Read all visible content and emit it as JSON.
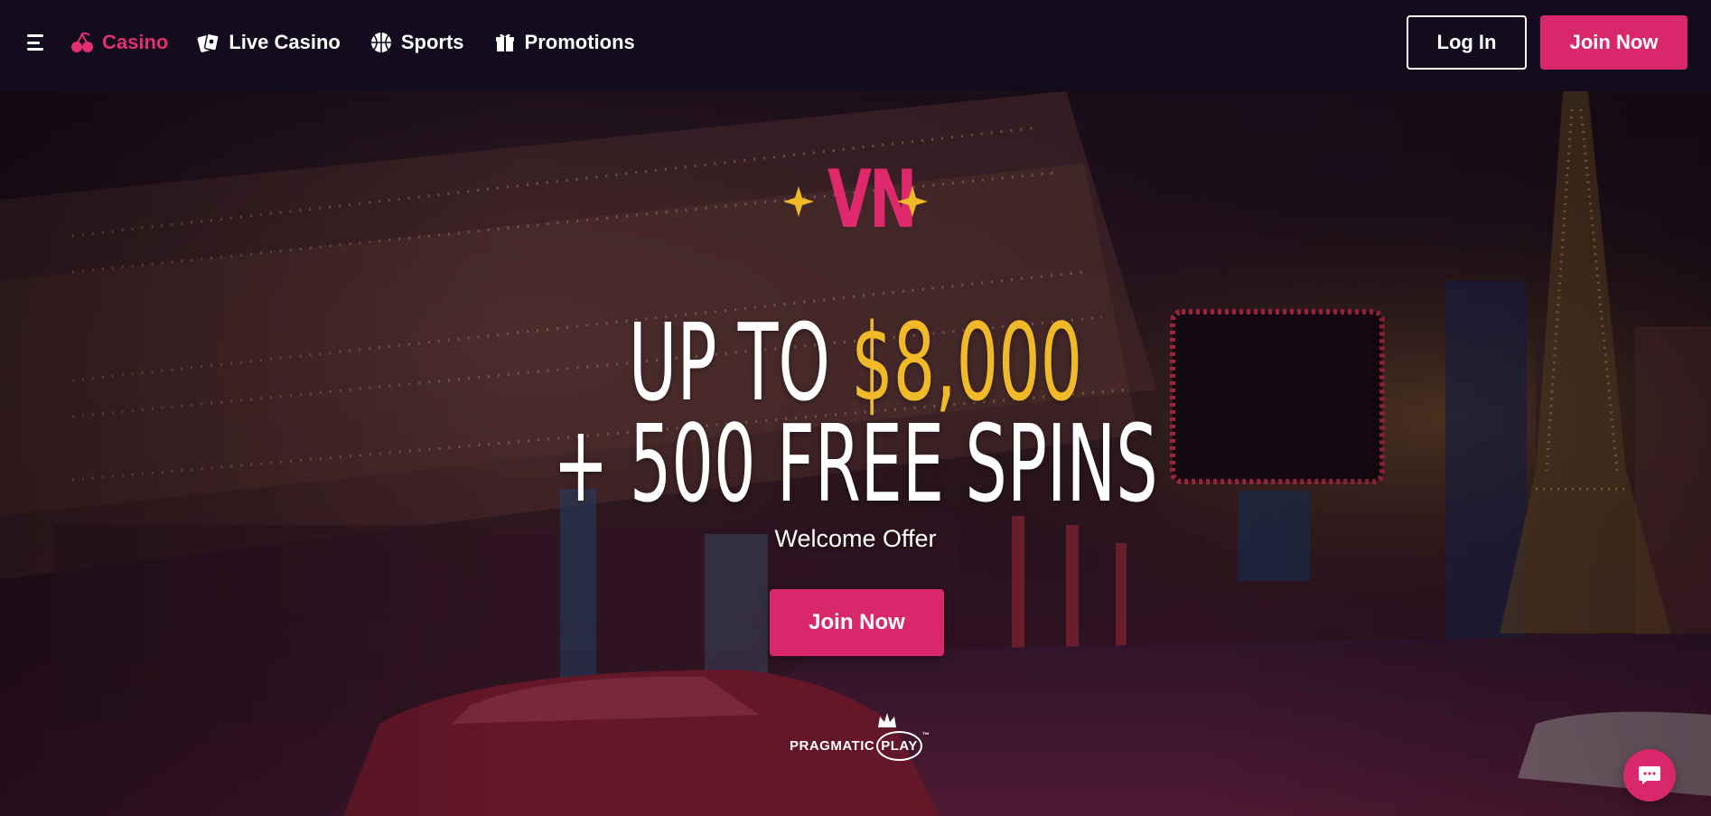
{
  "nav": {
    "menu_icon": "hamburger-menu-icon",
    "items": [
      {
        "label": "Casino",
        "icon": "cherries-icon",
        "active": true
      },
      {
        "label": "Live Casino",
        "icon": "playing-cards-icon",
        "active": false
      },
      {
        "label": "Sports",
        "icon": "basketball-icon",
        "active": false
      },
      {
        "label": "Promotions",
        "icon": "gift-icon",
        "active": false
      }
    ],
    "login_label": "Log In",
    "join_label": "Join Now"
  },
  "hero": {
    "logo_text": "VN",
    "headline_line1_prefix": "UP TO ",
    "headline_line1_amount": "$8,000",
    "headline_line2": "+ 500 FREE SPINS",
    "subtitle": "Welcome Offer",
    "cta_label": "Join Now",
    "provider_text": "PRAGMATIC",
    "provider_text_circle": "PLAY",
    "provider_tm": "™"
  },
  "chat": {
    "icon": "chat-bubble-icon"
  },
  "colors": {
    "brand_pink": "#d8286b",
    "active_nav": "#e2306f",
    "gold_accent": "#f0b928",
    "topbar_bg": "#130c1f"
  }
}
